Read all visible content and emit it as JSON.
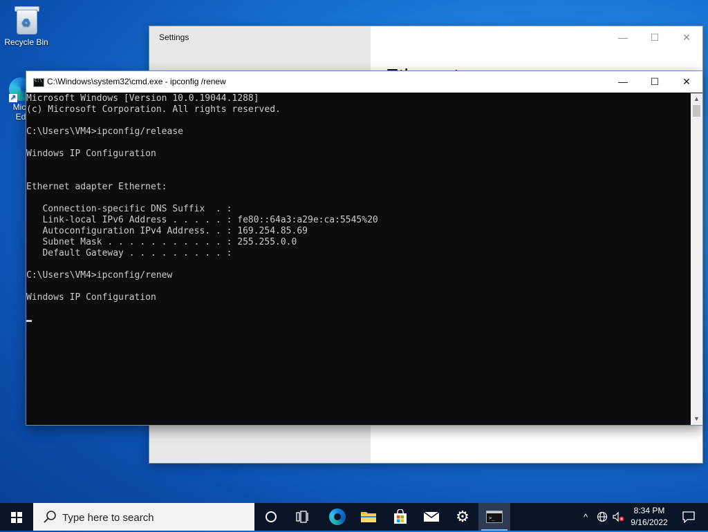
{
  "desktop": {
    "recycle_bin_label": "Recycle Bin",
    "edge_label_line1": "Micr",
    "edge_label_line2": "Ed"
  },
  "settings_window": {
    "title": "Settings",
    "heading": "Ethernet",
    "back_glyph": "←",
    "minimize_glyph": "—",
    "maximize_glyph": "☐",
    "close_glyph": "✕"
  },
  "cmd_window": {
    "title": "C:\\Windows\\system32\\cmd.exe - ipconfig /renew",
    "minimize_glyph": "—",
    "maximize_glyph": "☐",
    "close_glyph": "✕",
    "lines": [
      "Microsoft Windows [Version 10.0.19044.1288]",
      "(c) Microsoft Corporation. All rights reserved.",
      "",
      "C:\\Users\\VM4>ipconfig/release",
      "",
      "Windows IP Configuration",
      "",
      "",
      "Ethernet adapter Ethernet:",
      "",
      "   Connection-specific DNS Suffix  . :",
      "   Link-local IPv6 Address . . . . . : fe80::64a3:a29e:ca:5545%20",
      "   Autoconfiguration IPv4 Address. . : 169.254.85.69",
      "   Subnet Mask . . . . . . . . . . . : 255.255.0.0",
      "   Default Gateway . . . . . . . . . :",
      "",
      "C:\\Users\\VM4>ipconfig/renew",
      "",
      "Windows IP Configuration",
      "",
      ""
    ],
    "scroll_up_glyph": "▲",
    "scroll_down_glyph": "▼"
  },
  "taskbar": {
    "search_placeholder": "Type here to search",
    "clock_time": "8:34 PM",
    "clock_date": "9/16/2022",
    "tray_chevron": "^",
    "colors": {
      "taskbar_bg": "#0a1628",
      "active_highlight": "#76b9ed",
      "edge_blue": "#1676d8"
    }
  }
}
